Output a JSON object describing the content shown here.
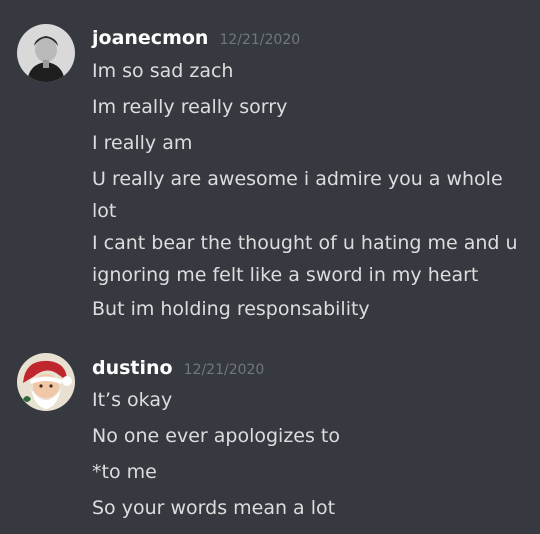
{
  "messages": [
    {
      "username": "joanecmon",
      "timestamp": "12/21/2020",
      "lines": [
        "Im so sad zach",
        "Im really really sorry",
        "I really am",
        "U really are awesome i admire you a whole lot",
        "I cant bear the thought of u hating me and u ignoring me felt like a sword in my heart",
        "But im holding responsability"
      ]
    },
    {
      "username": "dustino",
      "timestamp": "12/21/2020",
      "lines": [
        "It’s okay",
        "No one ever apologizes to",
        "*to me",
        "So your words mean a lot"
      ]
    }
  ],
  "colors": {
    "background": "#36393f",
    "username": "#ffffff",
    "message_text": "#dcddde",
    "timestamp": "#72767d"
  },
  "icons": {
    "avatar_1": "user-avatar-photo",
    "avatar_2": "user-avatar-santa"
  }
}
